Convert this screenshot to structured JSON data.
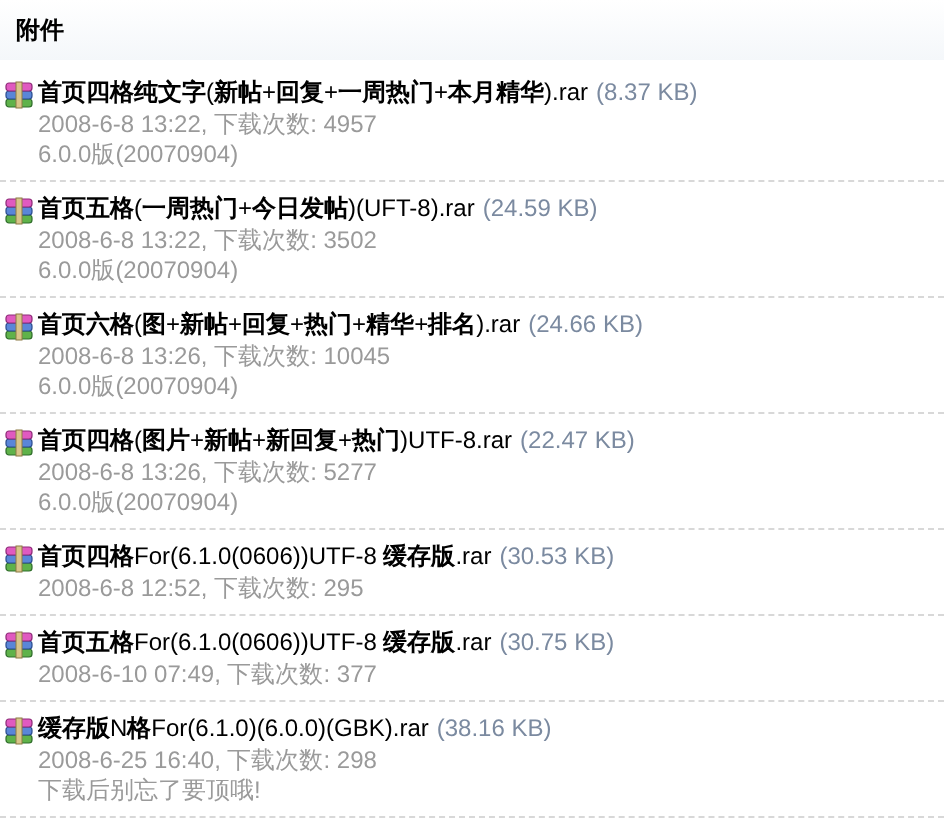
{
  "header": {
    "title": "附件"
  },
  "attachments": [
    {
      "name": " **首页四格纯文字**(**新帖**+**回复**+**一周热门**+**本月精华**).rar",
      "size": "(8.37 KB)",
      "details": [
        "2008-6-8 13:22, 下载次数: 4957",
        "6.0.0版(20070904)"
      ]
    },
    {
      "name": "**首页五格**(**一周热门**+**今日发帖**)(UFT-8).rar",
      "size": "(24.59 KB)",
      "details": [
        "2008-6-8 13:22, 下载次数: 3502",
        "6.0.0版(20070904)"
      ]
    },
    {
      "name": "**首页六格**(**图**+**新帖**+**回复**+**热门**+**精华**+**排名**).rar",
      "size": "(24.66 KB)",
      "details": [
        "2008-6-8 13:26, 下载次数: 10045",
        "6.0.0版(20070904)"
      ]
    },
    {
      "name": "**首页四格**(**图片**+**新帖**+**新回复**+**热门**)UTF-8.rar",
      "size": "(22.47 KB)",
      "details": [
        "2008-6-8 13:26, 下载次数: 5277",
        "6.0.0版(20070904)"
      ]
    },
    {
      "name": "**首页四格**For(6.1.0(0606))UTF-8 **缓存版**.rar",
      "size": "(30.53 KB)",
      "details": [
        "2008-6-8 12:52, 下载次数: 295"
      ]
    },
    {
      "name": "**首页五格**For(6.1.0(0606))UTF-8 **缓存版**.rar",
      "size": "(30.75 KB)",
      "details": [
        "2008-6-10 07:49, 下载次数: 377"
      ]
    },
    {
      "name": "**缓存版**N**格**For(6.1.0)(6.0.0)(GBK).rar",
      "size": "(38.16 KB)",
      "details": [
        "2008-6-25 16:40, 下载次数: 298",
        "下载后别忘了要顶哦!"
      ]
    }
  ]
}
